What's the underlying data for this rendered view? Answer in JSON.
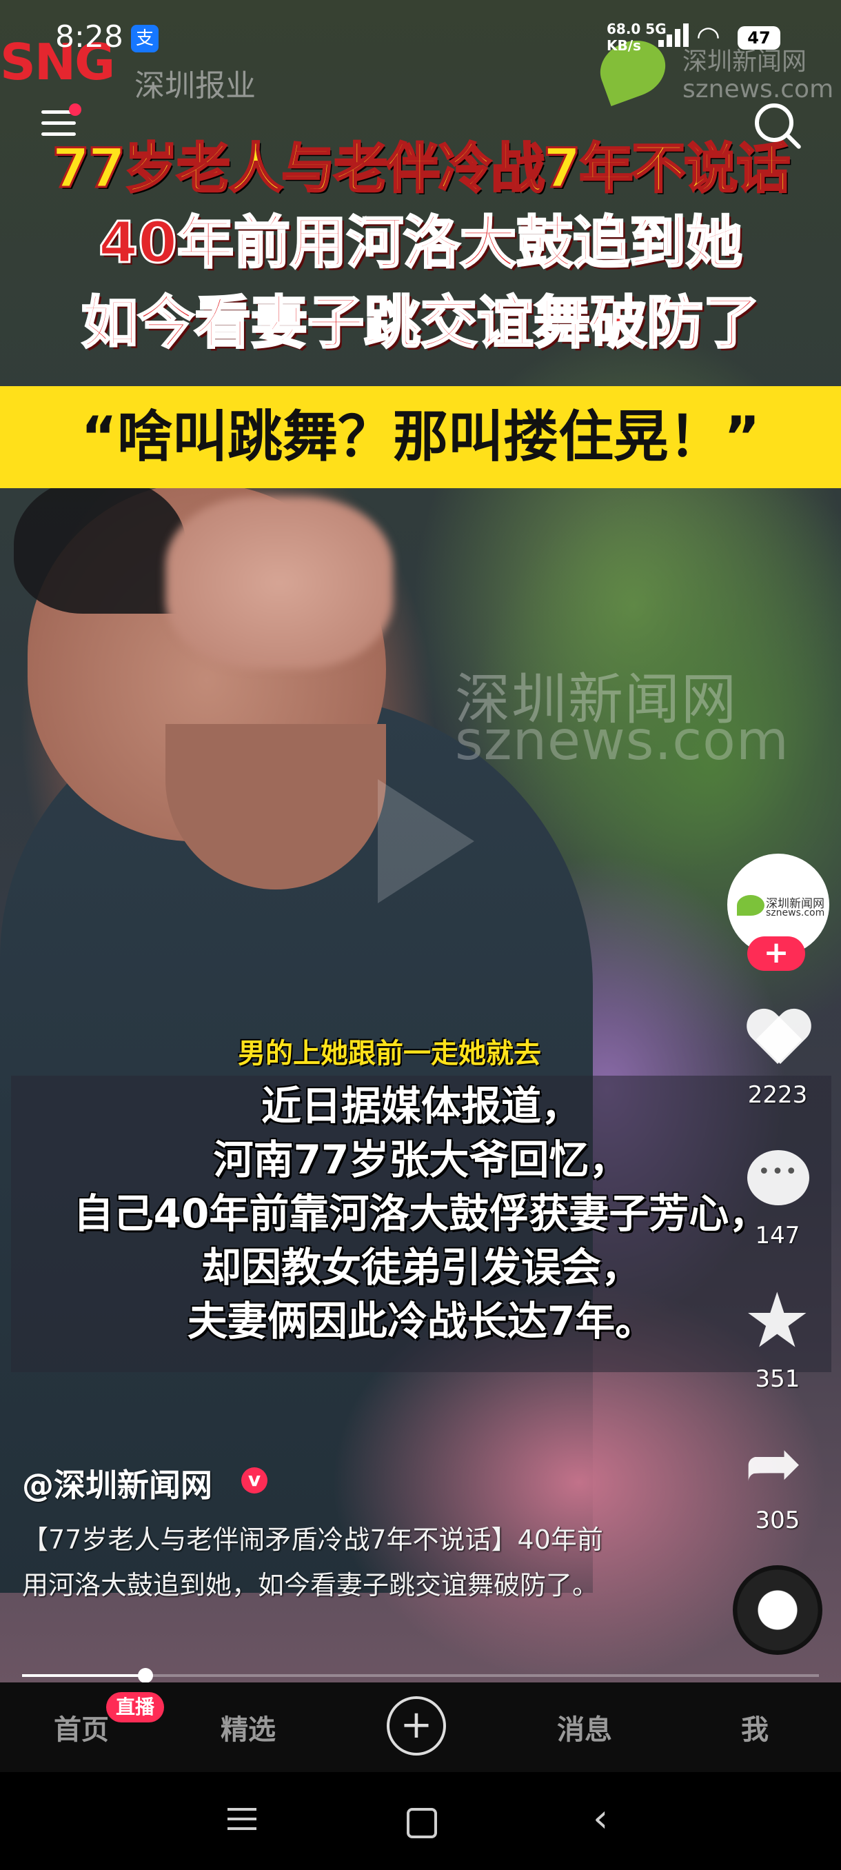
{
  "status_bar": {
    "time": "8:28",
    "pay_icon": "支",
    "net_speed_top": "68.0 5G",
    "net_speed_bottom": "KB/s",
    "battery": "47"
  },
  "watermarks": {
    "top_left_logo": "SNG",
    "top_left_text": "深圳报业",
    "top_right_line1": "深圳新闻网",
    "top_right_line2": "sznews.com",
    "center_cn": "深圳新闻网",
    "center_en": "sznews.com"
  },
  "video": {
    "headline_line1": "77岁老人与老伴冷战7年不说话",
    "headline_line2": "40年前用河洛大鼓追到她",
    "headline_line3": "如今看妻子跳交谊舞破防了",
    "quote": "“啥叫跳舞？那叫搂住晃！”",
    "subtitle_small": "男的上她跟前一走她就去",
    "caption_lines": [
      "近日据媒体报道，",
      "河南77岁张大爷回忆，",
      "自己40年前靠河洛大鼓俘获妻子芳心，",
      "却因教女徒弟引发误会，",
      "夫妻俩因此冷战长达7年。"
    ]
  },
  "rail": {
    "avatar_text1": "深圳新闻网",
    "avatar_text2": "sznews.com",
    "follow_label": "+",
    "likes": "2223",
    "comments": "147",
    "favorites": "351",
    "shares": "305"
  },
  "post": {
    "author": "@深圳新闻网",
    "verified": "v",
    "description": "【77岁老人与老伴闹矛盾冷战7年不说话】40年前用河洛大鼓追到她，如今看妻子跳交谊舞破防了。"
  },
  "progress": {
    "fraction": 0.155
  },
  "tabs": {
    "home": "首页",
    "live_badge": "直播",
    "featured": "精选",
    "add": "+",
    "messages": "消息",
    "me": "我"
  },
  "colors": {
    "accent": "#fe2c55",
    "headline_yellow": "#ffe21b",
    "headline_red": "#e3262a"
  }
}
